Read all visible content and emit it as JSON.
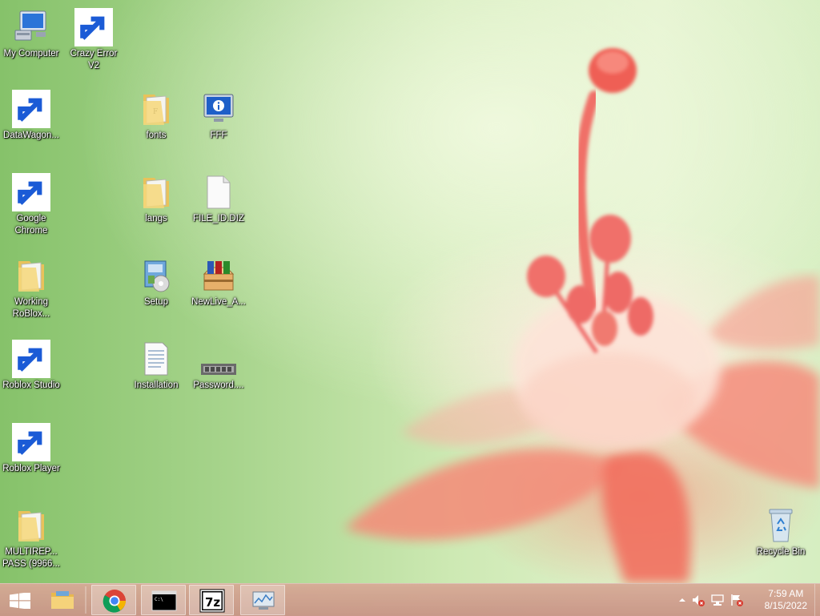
{
  "desktop": {
    "icons": [
      {
        "id": "my-computer",
        "label": "My Computer",
        "type": "computer"
      },
      {
        "id": "crazy-error",
        "label": "Crazy Error V2",
        "type": "app-window"
      },
      {
        "id": "datawagon",
        "label": "DataWagon...",
        "type": "datawagon"
      },
      {
        "id": "fonts",
        "label": "fonts",
        "type": "folder"
      },
      {
        "id": "fff",
        "label": "FFF",
        "type": "info-monitor"
      },
      {
        "id": "google-chrome",
        "label": "Google Chrome",
        "type": "chrome"
      },
      {
        "id": "langs",
        "label": "langs",
        "type": "folder"
      },
      {
        "id": "file-id-diz",
        "label": "FILE_ID.DIZ",
        "type": "file"
      },
      {
        "id": "working-roblox",
        "label": "Working RoBlox...",
        "type": "folder"
      },
      {
        "id": "setup",
        "label": "Setup",
        "type": "setup"
      },
      {
        "id": "newlive",
        "label": "NewLive_A...",
        "type": "winrar"
      },
      {
        "id": "roblox-studio",
        "label": "Roblox Studio",
        "type": "roblox-studio"
      },
      {
        "id": "installation",
        "label": "Installation",
        "type": "text-file"
      },
      {
        "id": "password",
        "label": "Password....",
        "type": "password"
      },
      {
        "id": "roblox-player",
        "label": "Roblox Player",
        "type": "roblox-player"
      },
      {
        "id": "multirep",
        "label": "MULTIREP... PASS (9966...",
        "type": "folder"
      },
      {
        "id": "recycle-bin",
        "label": "Recycle Bin",
        "type": "recycle"
      }
    ]
  },
  "taskbar": {
    "start": "start-icon",
    "apps": [
      {
        "name": "file-explorer",
        "icon": "folder-icon"
      },
      {
        "name": "google-chrome",
        "icon": "chrome-icon"
      },
      {
        "name": "command-prompt",
        "icon": "cmd-icon",
        "text": "C:\\"
      },
      {
        "name": "7zip",
        "icon": "7zip-icon",
        "text": "7z"
      },
      {
        "name": "performance-monitor",
        "icon": "monitor-icon"
      }
    ],
    "tray": {
      "icons": [
        "chevron-up-icon",
        "speaker-muted-icon",
        "network-icon",
        "action-center-flag-icon"
      ],
      "time": "7:59 AM",
      "date": "8/15/2022"
    }
  },
  "colors": {
    "accent": "#c8968a",
    "wallpaper_green": "#a7d48c",
    "flower_pink": "#f07a6e"
  }
}
